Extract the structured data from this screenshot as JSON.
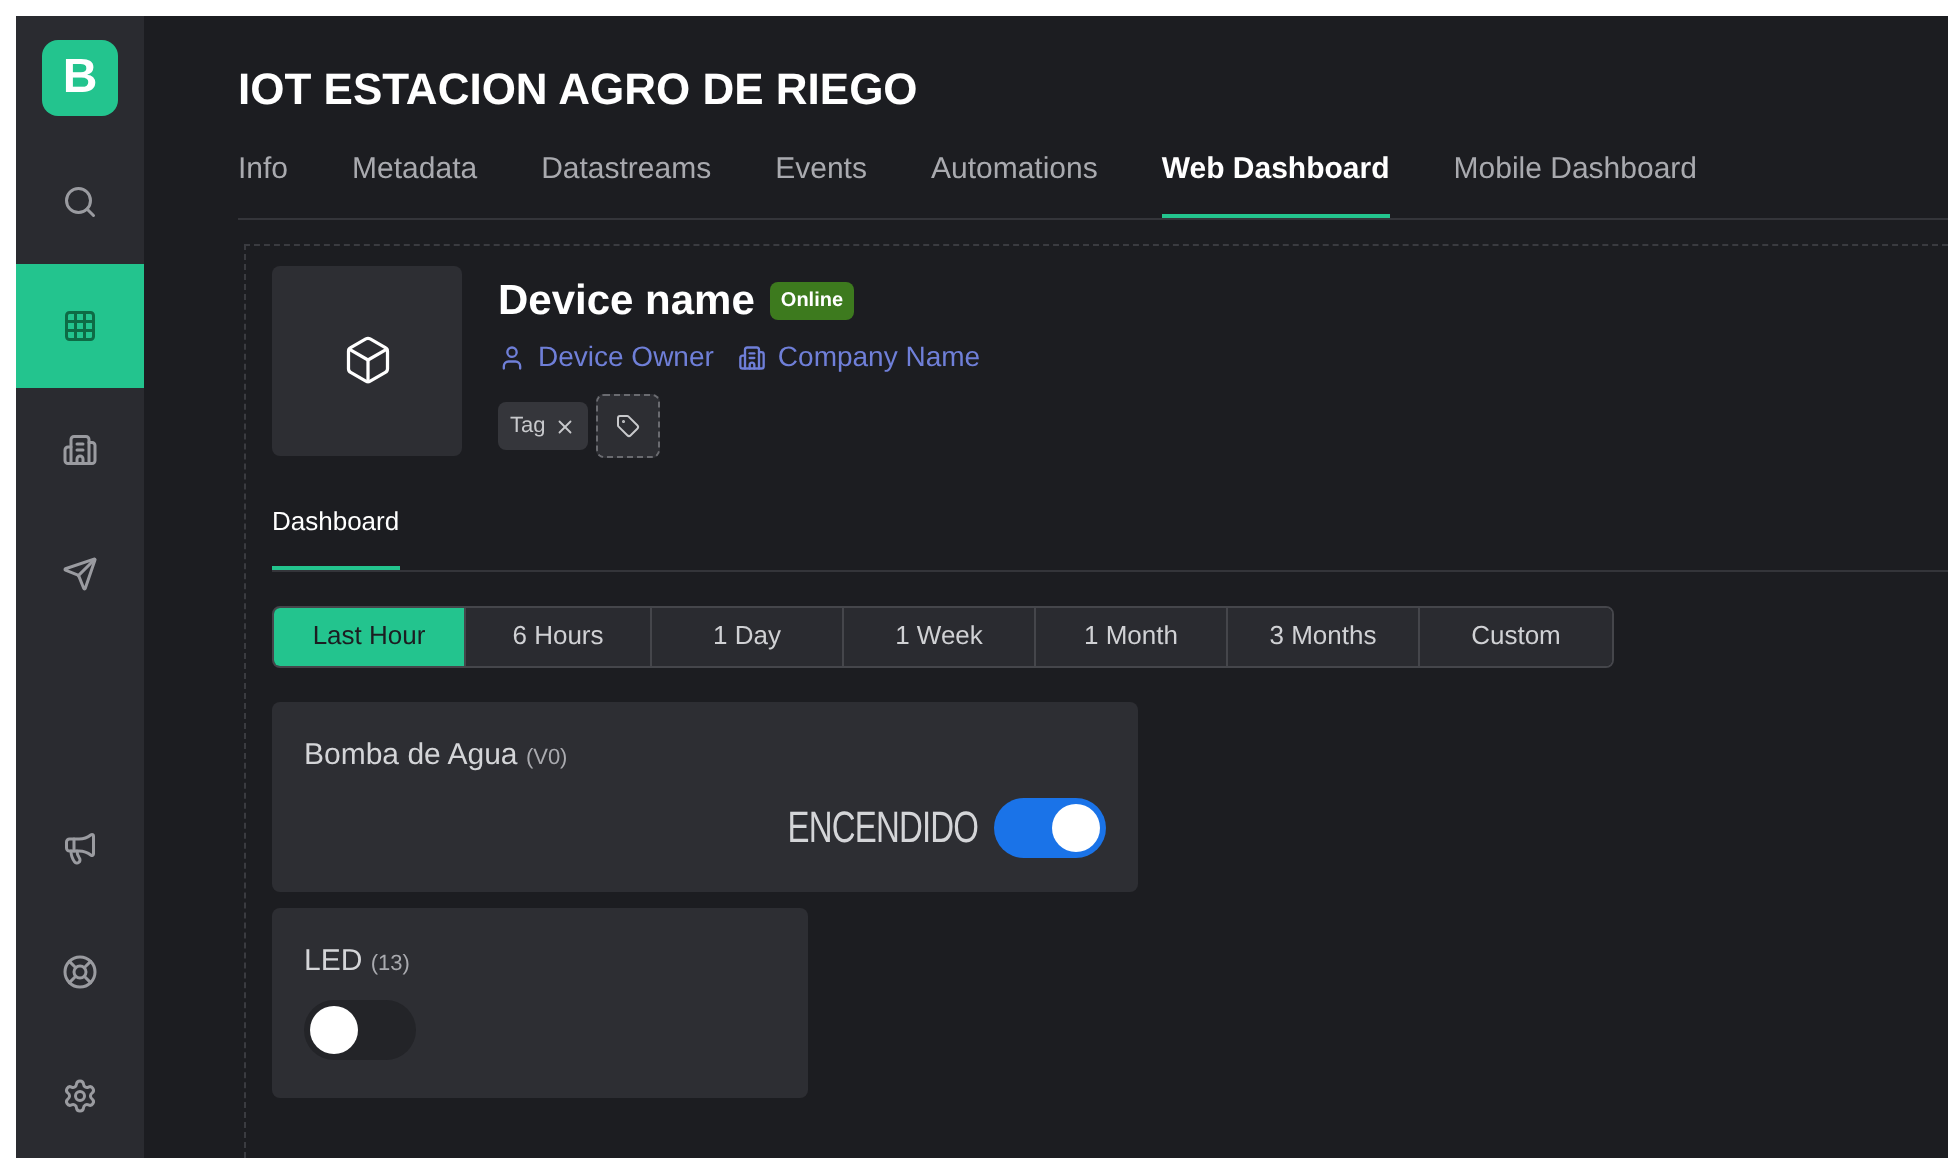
{
  "sidebar": {
    "logo": "B",
    "items": [
      {
        "selected": false
      },
      {
        "selected": true
      },
      {
        "selected": false
      },
      {
        "selected": false
      }
    ],
    "bottom_items": [
      {
        "selected": false
      },
      {
        "selected": false
      },
      {
        "selected": false
      }
    ]
  },
  "title": "IOT ESTACION AGRO DE RIEGO",
  "tabs": [
    {
      "label": "Info",
      "selected": false
    },
    {
      "label": "Metadata",
      "selected": false
    },
    {
      "label": "Datastreams",
      "selected": false
    },
    {
      "label": "Events",
      "selected": false
    },
    {
      "label": "Automations",
      "selected": false
    },
    {
      "label": "Web Dashboard",
      "selected": true
    },
    {
      "label": "Mobile Dashboard",
      "selected": false
    }
  ],
  "device": {
    "name": "Device name",
    "status": "Online",
    "owner": "Device Owner",
    "company": "Company Name",
    "tags": [
      "Tag"
    ]
  },
  "subtabs": [
    {
      "label": "Dashboard",
      "selected": true
    }
  ],
  "time_ranges": [
    {
      "label": "Last Hour",
      "selected": true
    },
    {
      "label": "6 Hours",
      "selected": false
    },
    {
      "label": "1 Day",
      "selected": false
    },
    {
      "label": "1 Week",
      "selected": false
    },
    {
      "label": "1 Month",
      "selected": false
    },
    {
      "label": "3 Months",
      "selected": false
    },
    {
      "label": "Custom",
      "selected": false
    }
  ],
  "widgets": [
    {
      "kind": "switch",
      "label": "Bomba de Agua",
      "pin": "(V0)",
      "value_text": "ENCENDIDO",
      "on": true
    },
    {
      "kind": "switch",
      "label": "LED",
      "pin": "(13)",
      "on": false
    }
  ]
}
